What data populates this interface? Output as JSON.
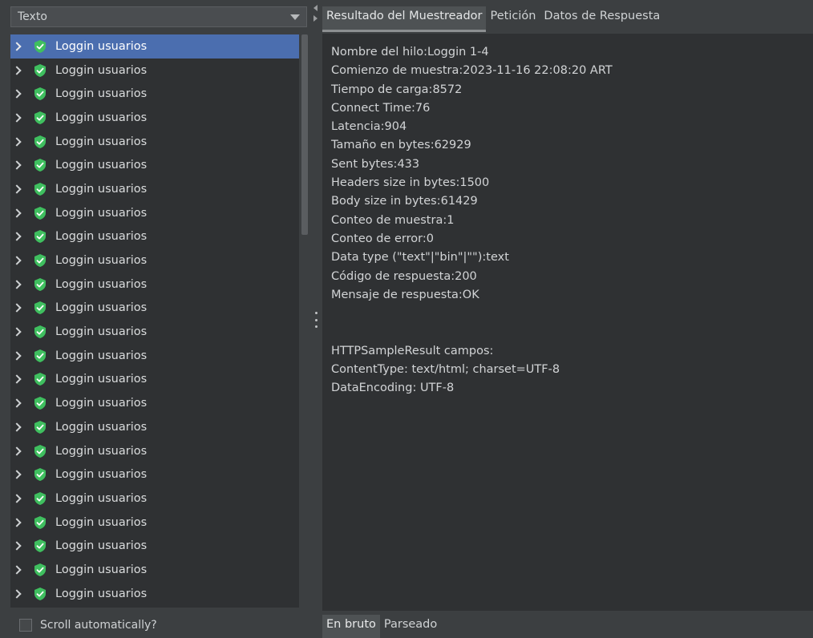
{
  "left": {
    "renderer_select": "Texto",
    "tree_items": [
      {
        "label": "Loggin usuarios",
        "selected": true
      },
      {
        "label": "Loggin usuarios"
      },
      {
        "label": "Loggin usuarios"
      },
      {
        "label": "Loggin usuarios"
      },
      {
        "label": "Loggin usuarios"
      },
      {
        "label": "Loggin usuarios"
      },
      {
        "label": "Loggin usuarios"
      },
      {
        "label": "Loggin usuarios"
      },
      {
        "label": "Loggin usuarios"
      },
      {
        "label": "Loggin usuarios"
      },
      {
        "label": "Loggin usuarios"
      },
      {
        "label": "Loggin usuarios"
      },
      {
        "label": "Loggin usuarios"
      },
      {
        "label": "Loggin usuarios"
      },
      {
        "label": "Loggin usuarios"
      },
      {
        "label": "Loggin usuarios"
      },
      {
        "label": "Loggin usuarios"
      },
      {
        "label": "Loggin usuarios"
      },
      {
        "label": "Loggin usuarios"
      },
      {
        "label": "Loggin usuarios"
      },
      {
        "label": "Loggin usuarios"
      },
      {
        "label": "Loggin usuarios"
      },
      {
        "label": "Loggin usuarios"
      },
      {
        "label": "Loggin usuarios"
      },
      {
        "label": "Loggin usuarios"
      }
    ],
    "scroll_label": "Scroll automatically?",
    "scroll_checked": false
  },
  "tabs": [
    {
      "label": "Resultado del Muestreador",
      "active": true
    },
    {
      "label": "Petición"
    },
    {
      "label": "Datos de Respuesta"
    }
  ],
  "result_lines": [
    "Nombre del hilo:Loggin 1-4",
    "Comienzo de muestra:2023-11-16 22:08:20 ART",
    "Tiempo de carga:8572",
    "Connect Time:76",
    "Latencia:904",
    "Tamaño en bytes:62929",
    "Sent bytes:433",
    "Headers size in bytes:1500",
    "Body size in bytes:61429",
    "Conteo de muestra:1",
    "Conteo de error:0",
    "Data type (\"text\"|\"bin\"|\"\"):text",
    "Código de respuesta:200",
    "Mensaje de respuesta:OK",
    "",
    "",
    "HTTPSampleResult campos:",
    "ContentType: text/html; charset=UTF-8",
    "DataEncoding: UTF-8"
  ],
  "bottom_tabs": [
    {
      "label": "En bruto",
      "active": true
    },
    {
      "label": "Parseado"
    }
  ],
  "colors": {
    "success_shield": "#3fbf5f",
    "selection": "#4b6eaf"
  },
  "icons": {
    "tree_item": "success-shield-icon",
    "expander": "chevron-right-icon"
  }
}
